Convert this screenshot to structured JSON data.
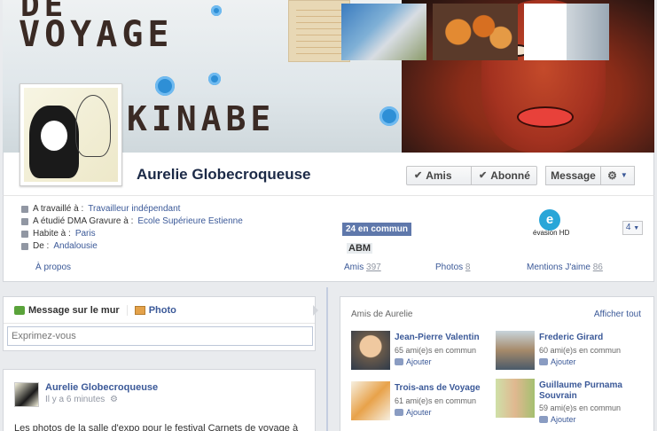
{
  "cover": {
    "title_lines": [
      "DE",
      "VOYAGE",
      "KINABE"
    ]
  },
  "profile": {
    "name": "Aurelie Globecroqueuse",
    "buttons": {
      "friends": "Amis",
      "following": "Abonné",
      "message": "Message",
      "settings_icon": "gear-icon"
    }
  },
  "info": [
    {
      "label": "A travaillé à : ",
      "value": "Travailleur indépendant"
    },
    {
      "label": "A étudié DMA Gravure à : ",
      "value": "Ecole Supérieure Estienne"
    },
    {
      "label": "Habite à : ",
      "value": "Paris"
    },
    {
      "label": "De : ",
      "value": "Andalousie"
    }
  ],
  "about_link": "À propos",
  "tiles": {
    "friends": {
      "label": "Amis",
      "count": "397",
      "badge": "24 en commun",
      "overlay": "ABM"
    },
    "photos": {
      "label": "Photos",
      "count": "8"
    },
    "likes": {
      "label": "Mentions J'aime",
      "count": "86",
      "logo_letter": "e",
      "brand": "évasion HD"
    },
    "pager": "4"
  },
  "composer": {
    "status_tab": "Message sur le mur",
    "photo_tab": "Photo",
    "placeholder": "Exprimez-vous"
  },
  "post": {
    "author": "Aurelie Globecroqueuse",
    "time": "Il y a 6 minutes",
    "text": "Les photos de la salle d'expo pour le festival Carnets de voyage à"
  },
  "friends_panel": {
    "title": "Amis de Aurelie",
    "see_all": "Afficher tout",
    "add_label": "Ajouter",
    "items": [
      {
        "name": "Jean-Pierre Valentin",
        "common": "65 ami(e)s en commun"
      },
      {
        "name": "Frederic Girard",
        "common": "60 ami(e)s en commun"
      },
      {
        "name": "Trois-ans de Voyage",
        "common": "61 ami(e)s en commun"
      },
      {
        "name": "Guillaume Purnama Souvrain",
        "common": "59 ami(e)s en commun"
      }
    ]
  },
  "colors": {
    "link": "#3b5998",
    "name": "#1c2a47",
    "page_bg": "#e9ebee"
  }
}
